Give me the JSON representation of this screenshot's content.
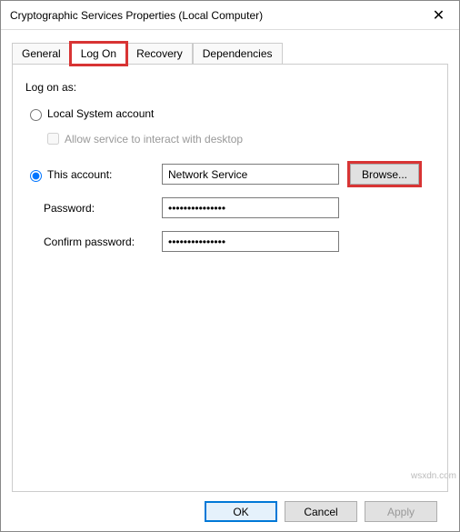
{
  "titlebar": {
    "title": "Cryptographic Services Properties (Local Computer)"
  },
  "tabs": {
    "general": "General",
    "logon": "Log On",
    "recovery": "Recovery",
    "dependencies": "Dependencies",
    "selected": "Log On"
  },
  "panel": {
    "heading": "Log on as:",
    "local_system": "Local System account",
    "interact_desktop": "Allow service to interact with desktop",
    "this_account_label": "This account:",
    "this_account_value": "Network Service",
    "browse_label": "Browse...",
    "password_label": "Password:",
    "password_value": "•••••••••••••••",
    "confirm_label": "Confirm password:",
    "confirm_value": "•••••••••••••••"
  },
  "buttons": {
    "ok": "OK",
    "cancel": "Cancel",
    "apply": "Apply"
  },
  "watermark": "wsxdn.com"
}
